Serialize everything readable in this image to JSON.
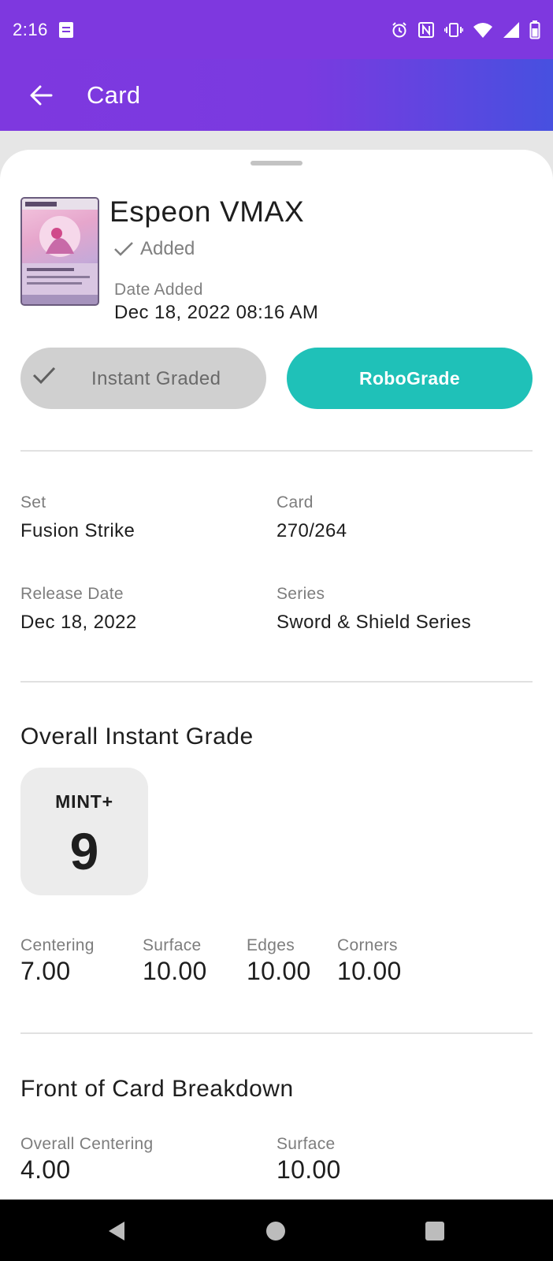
{
  "status_bar": {
    "time": "2:16",
    "icons": [
      "note-icon",
      "alarm-icon",
      "nfc-icon",
      "vibrate-icon",
      "wifi-icon",
      "signal-icon",
      "battery-icon"
    ]
  },
  "app_bar": {
    "title": "Card"
  },
  "card": {
    "name": "Espeon VMAX",
    "added_label": "Added",
    "date_added_label": "Date Added",
    "date_added": "Dec 18, 2022 08:16 AM"
  },
  "actions": {
    "instant_graded_label": "Instant Graded",
    "robograde_label": "RoboGrade"
  },
  "details": {
    "set_label": "Set",
    "set_value": "Fusion Strike",
    "card_label": "Card",
    "card_value": "270/264",
    "release_label": "Release Date",
    "release_value": "Dec 18, 2022",
    "series_label": "Series",
    "series_value": "Sword & Shield Series"
  },
  "overall_grade": {
    "title": "Overall Instant Grade",
    "grade_label": "MINT+",
    "grade_value": "9",
    "subgrades": [
      {
        "label": "Centering",
        "value": "7.00"
      },
      {
        "label": "Surface",
        "value": "10.00"
      },
      {
        "label": "Edges",
        "value": "10.00"
      },
      {
        "label": "Corners",
        "value": "10.00"
      }
    ]
  },
  "front_breakdown": {
    "title": "Front of Card Breakdown",
    "items": [
      {
        "label": "Overall Centering",
        "value": "4.00"
      },
      {
        "label": "Surface",
        "value": "10.00"
      }
    ]
  },
  "colors": {
    "status_bar": "#7e38df",
    "app_bar_start": "#7e38df",
    "app_bar_end": "#4750e0",
    "robograde_button": "#1fc1b8",
    "instant_button": "#d0d0d0"
  }
}
